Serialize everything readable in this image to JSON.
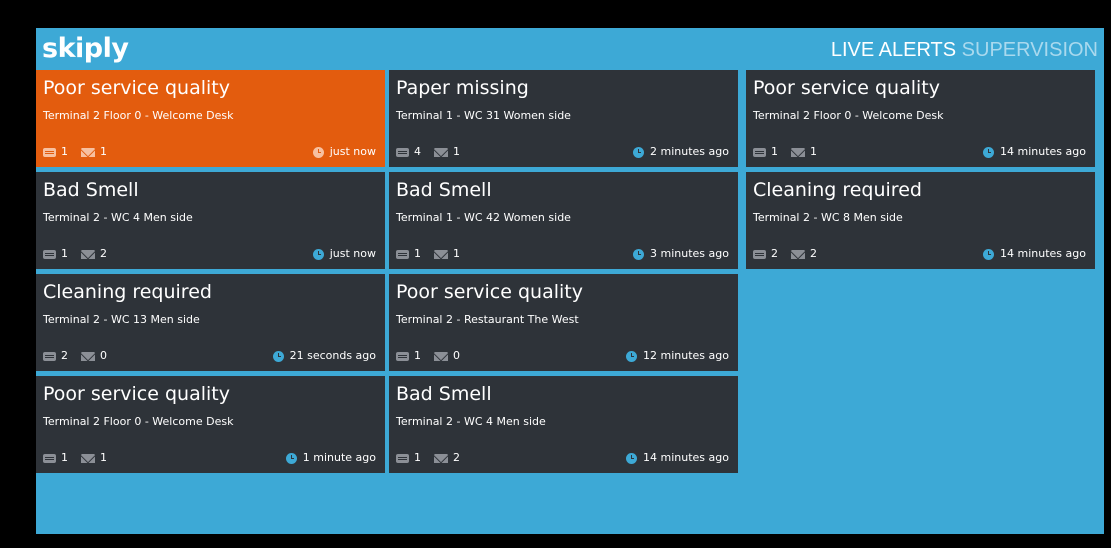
{
  "header": {
    "logo": "skiply",
    "title_live": "LIVE ALERTS",
    "title_supervision": "SUPERVISION"
  },
  "colors": {
    "background": "#3da9d6",
    "card": "#2e3339",
    "highlight": "#e35c0e"
  },
  "alerts": [
    {
      "title": "Poor service quality",
      "location": "Terminal 2 Floor 0 - Welcome Desk",
      "comments": "1",
      "messages": "1",
      "time": "just now",
      "highlight": true
    },
    {
      "title": "Paper missing",
      "location": "Terminal 1 - WC 31 Women side",
      "comments": "4",
      "messages": "1",
      "time": "2 minutes ago"
    },
    {
      "title": "Poor service quality",
      "location": "Terminal 2 Floor 0 - Welcome Desk",
      "comments": "1",
      "messages": "1",
      "time": "14 minutes ago"
    },
    {
      "title": "Bad Smell",
      "location": "Terminal 2 - WC 4 Men side",
      "comments": "1",
      "messages": "2",
      "time": "just now"
    },
    {
      "title": "Bad Smell",
      "location": "Terminal 1 - WC 42 Women side",
      "comments": "1",
      "messages": "1",
      "time": "3 minutes ago"
    },
    {
      "title": "Cleaning required",
      "location": "Terminal 2 - WC 8 Men side",
      "comments": "2",
      "messages": "2",
      "time": "14 minutes ago"
    },
    {
      "title": "Cleaning required",
      "location": "Terminal 2 - WC 13 Men side",
      "comments": "2",
      "messages": "0",
      "time": "21 seconds ago"
    },
    {
      "title": "Poor service quality",
      "location": "Terminal 2 - Restaurant The West",
      "comments": "1",
      "messages": "0",
      "time": "12 minutes ago"
    },
    {
      "title": "Poor service quality",
      "location": "Terminal 2 Floor 0 - Welcome Desk",
      "comments": "1",
      "messages": "1",
      "time": "1 minute ago"
    },
    {
      "title": "Bad Smell",
      "location": "Terminal 2 - WC 4 Men side",
      "comments": "1",
      "messages": "2",
      "time": "14 minutes ago"
    }
  ]
}
